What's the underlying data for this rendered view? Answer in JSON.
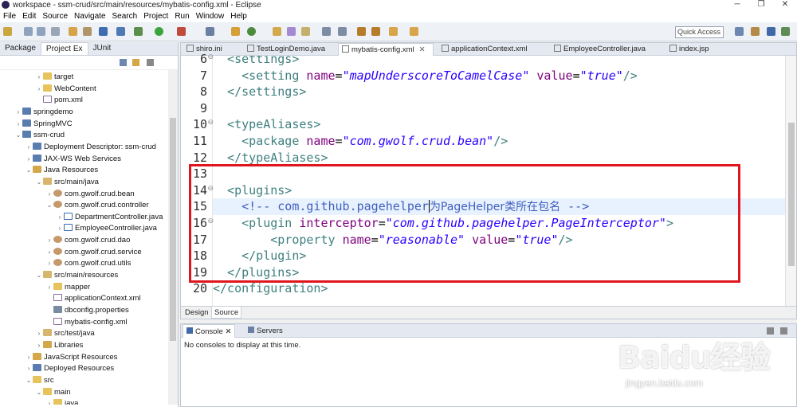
{
  "window": {
    "title": "workspace - ssm-crud/src/main/resources/mybatis-config.xml - Eclipse",
    "controls": [
      "─",
      "❐",
      "✕"
    ]
  },
  "menu": [
    "File",
    "Edit",
    "Source",
    "Navigate",
    "Search",
    "Project",
    "Run",
    "Window",
    "Help"
  ],
  "toolbar": {
    "quick_access_placeholder": "Quick Access"
  },
  "left_panel": {
    "tabs": [
      "Package",
      "Project Ex",
      "JUnit"
    ],
    "tree": [
      {
        "label": "target",
        "icon": "folder-icon",
        "depth": 2,
        "expander": "›"
      },
      {
        "label": "WebContent",
        "icon": "folder-icon",
        "depth": 2,
        "expander": "›"
      },
      {
        "label": "pom.xml",
        "icon": "xml-file-icon",
        "depth": 2,
        "expander": ""
      },
      {
        "label": "springdemo",
        "icon": "project-icon",
        "depth": 0,
        "expander": "›"
      },
      {
        "label": "SpringMVC",
        "icon": "project-icon",
        "depth": 0,
        "expander": "›"
      },
      {
        "label": "ssm-crud",
        "icon": "project-icon",
        "depth": 0,
        "expander": "⌄"
      },
      {
        "label": "Deployment Descriptor: ssm-crud",
        "icon": "descriptor-icon",
        "depth": 1,
        "expander": "›"
      },
      {
        "label": "JAX-WS Web Services",
        "icon": "webservice-icon",
        "depth": 1,
        "expander": "›"
      },
      {
        "label": "Java Resources",
        "icon": "java-resources-icon",
        "depth": 1,
        "expander": "⌄"
      },
      {
        "label": "src/main/java",
        "icon": "source-folder-icon",
        "depth": 2,
        "expander": "⌄"
      },
      {
        "label": "com.gwolf.crud.bean",
        "icon": "package-icon",
        "depth": 3,
        "expander": "›"
      },
      {
        "label": "com.gwolf.crud.controller",
        "icon": "package-icon",
        "depth": 3,
        "expander": "⌄"
      },
      {
        "label": "DepartmentController.java",
        "icon": "java-file-icon",
        "depth": 4,
        "expander": "›"
      },
      {
        "label": "EmployeeController.java",
        "icon": "java-file-icon",
        "depth": 4,
        "expander": "›"
      },
      {
        "label": "com.gwolf.crud.dao",
        "icon": "package-icon",
        "depth": 3,
        "expander": "›"
      },
      {
        "label": "com.gwolf.crud.service",
        "icon": "package-icon",
        "depth": 3,
        "expander": "›"
      },
      {
        "label": "com.gwolf.crud.utils",
        "icon": "package-icon",
        "depth": 3,
        "expander": "›"
      },
      {
        "label": "src/main/resources",
        "icon": "source-folder-icon",
        "depth": 2,
        "expander": "⌄"
      },
      {
        "label": "mapper",
        "icon": "folder-icon",
        "depth": 3,
        "expander": "›"
      },
      {
        "label": "applicationContext.xml",
        "icon": "xml-file-icon",
        "depth": 3,
        "expander": ""
      },
      {
        "label": "dbconfig.properties",
        "icon": "properties-file-icon",
        "depth": 3,
        "expander": ""
      },
      {
        "label": "mybatis-config.xml",
        "icon": "xml-file-icon",
        "depth": 3,
        "expander": ""
      },
      {
        "label": "src/test/java",
        "icon": "source-folder-icon",
        "depth": 2,
        "expander": "›"
      },
      {
        "label": "Libraries",
        "icon": "library-icon",
        "depth": 2,
        "expander": "›"
      },
      {
        "label": "JavaScript Resources",
        "icon": "js-resources-icon",
        "depth": 1,
        "expander": "›"
      },
      {
        "label": "Deployed Resources",
        "icon": "deployed-resources-icon",
        "depth": 1,
        "expander": "›"
      },
      {
        "label": "src",
        "icon": "folder-icon",
        "depth": 1,
        "expander": "⌄"
      },
      {
        "label": "main",
        "icon": "folder-icon",
        "depth": 2,
        "expander": "⌄"
      },
      {
        "label": "java",
        "icon": "folder-icon",
        "depth": 3,
        "expander": "›"
      }
    ]
  },
  "editor": {
    "tabs": [
      {
        "label": "shiro.ini",
        "active": false
      },
      {
        "label": "TestLoginDemo.java",
        "active": false
      },
      {
        "label": "mybatis-config.xml",
        "active": true
      },
      {
        "label": "applicationContext.xml",
        "active": false
      },
      {
        "label": "EmployeeController.java",
        "active": false
      },
      {
        "label": "index.jsp",
        "active": false
      }
    ],
    "lines": [
      {
        "num": "6",
        "fold": "⊖",
        "tokens": [
          {
            "t": "  <settings>",
            "c": "tag"
          }
        ]
      },
      {
        "num": "7",
        "fold": "",
        "tokens": [
          {
            "t": "    <setting ",
            "c": "tag"
          },
          {
            "t": "name",
            "c": "attr"
          },
          {
            "t": "=",
            "c": ""
          },
          {
            "t": "\"mapUnderscoreToCamelCase\"",
            "c": "val"
          },
          {
            "t": " ",
            "c": ""
          },
          {
            "t": "value",
            "c": "attr"
          },
          {
            "t": "=",
            "c": ""
          },
          {
            "t": "\"true\"",
            "c": "val"
          },
          {
            "t": "/>",
            "c": "tag"
          }
        ]
      },
      {
        "num": "8",
        "fold": "",
        "tokens": [
          {
            "t": "  </settings>",
            "c": "tag"
          }
        ]
      },
      {
        "num": "9",
        "fold": "",
        "tokens": []
      },
      {
        "num": "10",
        "fold": "⊖",
        "tokens": [
          {
            "t": "  <typeAliases>",
            "c": "tag"
          }
        ]
      },
      {
        "num": "11",
        "fold": "",
        "tokens": [
          {
            "t": "    <package ",
            "c": "tag"
          },
          {
            "t": "name",
            "c": "attr"
          },
          {
            "t": "=",
            "c": ""
          },
          {
            "t": "\"com.gwolf.crud.bean\"",
            "c": "val"
          },
          {
            "t": "/>",
            "c": "tag"
          }
        ]
      },
      {
        "num": "12",
        "fold": "",
        "tokens": [
          {
            "t": "  </typeAliases>",
            "c": "tag"
          }
        ]
      },
      {
        "num": "13",
        "fold": "",
        "tokens": []
      },
      {
        "num": "14",
        "fold": "⊖",
        "tokens": [
          {
            "t": "  <plugins>",
            "c": "tag"
          }
        ]
      },
      {
        "num": "15",
        "fold": "",
        "highlight": true,
        "tokens": [
          {
            "t": "    <!-- com.github.pagehelper",
            "c": "cmt"
          },
          {
            "t": "|",
            "c": "caret"
          },
          {
            "t": "为PageHelper类所在包名",
            "c": "cmt-cjk"
          },
          {
            "t": " -->",
            "c": "cmt"
          }
        ]
      },
      {
        "num": "16",
        "fold": "⊖",
        "tokens": [
          {
            "t": "    <plugin ",
            "c": "tag"
          },
          {
            "t": "interceptor",
            "c": "attr"
          },
          {
            "t": "=",
            "c": ""
          },
          {
            "t": "\"com.github.pagehelper.PageInterceptor\"",
            "c": "val"
          },
          {
            "t": ">",
            "c": "tag"
          }
        ]
      },
      {
        "num": "17",
        "fold": "",
        "tokens": [
          {
            "t": "        <property ",
            "c": "tag"
          },
          {
            "t": "name",
            "c": "attr"
          },
          {
            "t": "=",
            "c": ""
          },
          {
            "t": "\"reasonable\"",
            "c": "val"
          },
          {
            "t": " ",
            "c": ""
          },
          {
            "t": "value",
            "c": "attr"
          },
          {
            "t": "=",
            "c": ""
          },
          {
            "t": "\"true\"",
            "c": "val"
          },
          {
            "t": "/>",
            "c": "tag"
          }
        ]
      },
      {
        "num": "18",
        "fold": "",
        "tokens": [
          {
            "t": "    </plugin>",
            "c": "tag"
          }
        ]
      },
      {
        "num": "19",
        "fold": "",
        "tokens": [
          {
            "t": "  </plugins>",
            "c": "tag"
          }
        ]
      },
      {
        "num": "20",
        "fold": "",
        "tokens": [
          {
            "t": "</configuration>",
            "c": "tag"
          }
        ]
      }
    ],
    "bottom_tabs": [
      "Design",
      "Source"
    ]
  },
  "console": {
    "tabs": [
      "Console",
      "Servers"
    ],
    "message": "No consoles to display at this time."
  },
  "watermark": {
    "main": "Baidu经验",
    "sub": "jingyan.baidu.com"
  },
  "colors": {
    "annotation_box": "#e0161f",
    "tag": "#3f7f7f",
    "attribute": "#7f007f",
    "value": "#2a00ff",
    "comment": "#3f5fbf",
    "current_line": "#e8f2fe"
  }
}
